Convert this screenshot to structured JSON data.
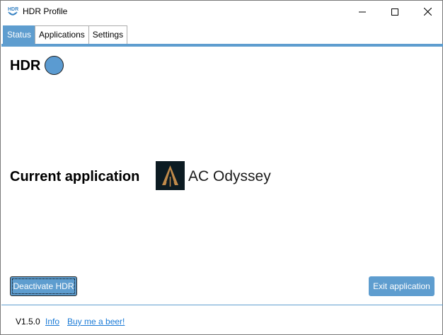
{
  "window": {
    "title": "HDR Profile",
    "app_icon": "hdr-logo-icon",
    "controls": [
      "minimize-icon",
      "maximize-icon",
      "close-icon"
    ]
  },
  "tabs": [
    {
      "label": "Status",
      "active": true
    },
    {
      "label": "Applications",
      "active": false
    },
    {
      "label": "Settings",
      "active": false
    }
  ],
  "status": {
    "hdr_label": "HDR",
    "hdr_indicator_color": "#5b9bd1",
    "current_app_label": "Current application",
    "current_app_name": "AC Odyssey",
    "current_app_icon": "ac-odyssey-icon"
  },
  "buttons": {
    "deactivate": "Deactivate HDR",
    "exit": "Exit application"
  },
  "footer": {
    "version": "V1.5.0",
    "info_link": "Info",
    "beer_link": "Buy me a beer!"
  },
  "colors": {
    "accent": "#5e9dcf",
    "link": "#1a7ad6"
  }
}
